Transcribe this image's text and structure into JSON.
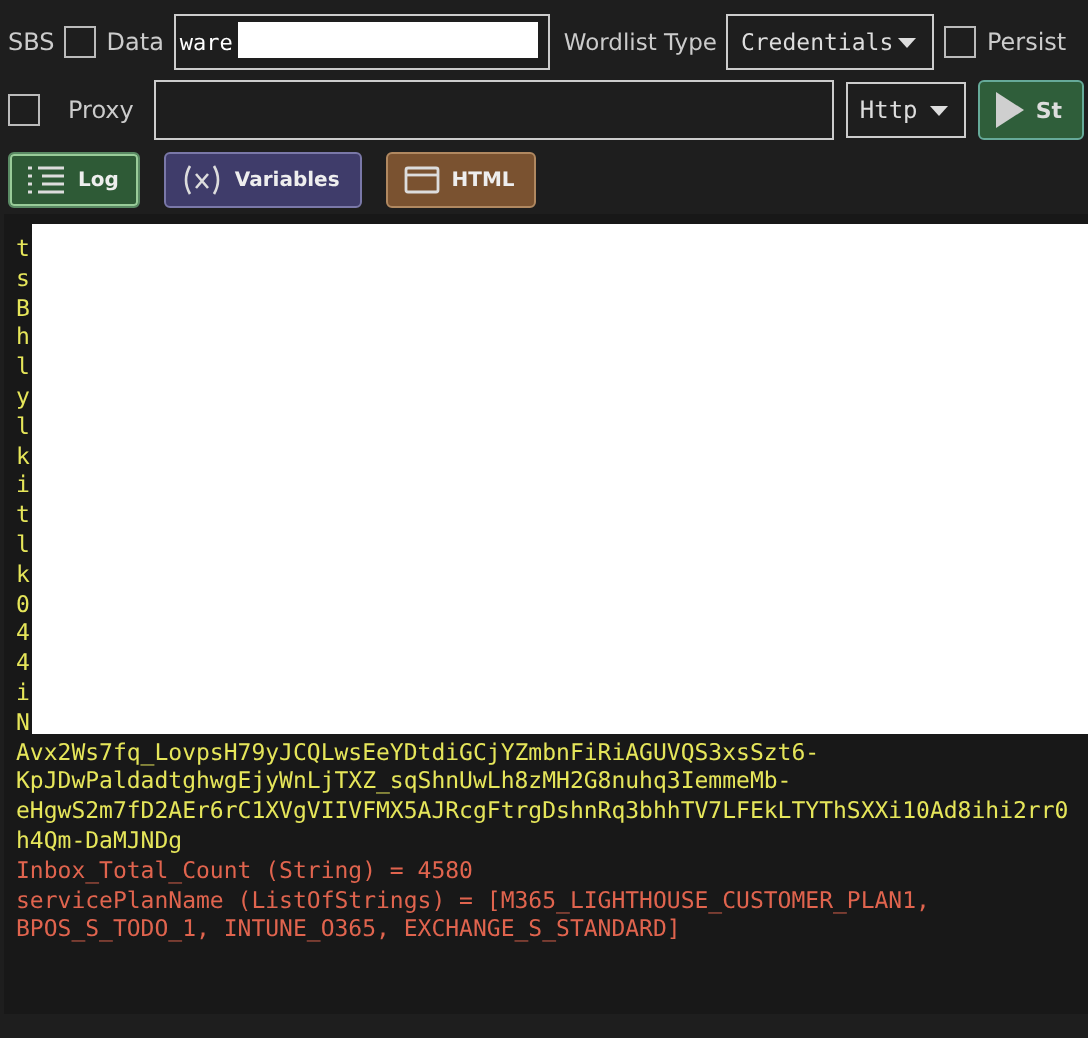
{
  "toolbar": {
    "sbs_label": "SBS",
    "data_checkbox": {
      "checked": false
    },
    "data_label": "Data",
    "data_field": {
      "value": "ware"
    },
    "wordlist_label": "Wordlist Type",
    "wordlist_select": {
      "value": "Credentials"
    },
    "persist_checkbox": {
      "checked": false
    },
    "persist_label": "Persist"
  },
  "proxy_row": {
    "proxy_checkbox": {
      "checked": false
    },
    "proxy_label": "Proxy",
    "proxy_type": {
      "value": "Http"
    },
    "start_button": "St"
  },
  "tabs": [
    {
      "label": "Log",
      "kind": "log",
      "selected": true
    },
    {
      "label": "Variables",
      "kind": "variables",
      "selected": false
    },
    {
      "label": "HTML",
      "kind": "html",
      "selected": false
    }
  ],
  "log": {
    "lines": [
      {
        "kind": "edge",
        "start": "t"
      },
      {
        "kind": "edge",
        "start": "s"
      },
      {
        "kind": "edge",
        "start": "B"
      },
      {
        "kind": "edge",
        "start": "h"
      },
      {
        "kind": "edge",
        "start": "l"
      },
      {
        "kind": "edge",
        "start": "y"
      },
      {
        "kind": "edge",
        "start": "l"
      },
      {
        "kind": "edge",
        "start": "k"
      },
      {
        "kind": "edge",
        "start": "i"
      },
      {
        "kind": "edge",
        "start": "t"
      },
      {
        "kind": "edge",
        "start": "l"
      },
      {
        "kind": "edge",
        "start": "k"
      },
      {
        "kind": "edge",
        "start": "0"
      },
      {
        "kind": "edge",
        "start": "4"
      },
      {
        "kind": "edge",
        "start": "4"
      },
      {
        "kind": "edge",
        "start": "i"
      },
      {
        "kind": "edge",
        "start": "N"
      },
      {
        "kind": "output",
        "text": "Avx2Ws7fq_LovpsH79yJCQLwsEeYDtdiGCjYZmbnFiRiAGUVQS3xsSzt6-"
      },
      {
        "kind": "output",
        "text": "KpJDwPaldadtghwgEjyWnLjTXZ_sqShnUwLh8zMH2G8nuhq3IemmeMb-"
      },
      {
        "kind": "output",
        "text": "eHgwS2m7fD2AEr6rC1XVgVIIVFMX5AJRcgFtrgDshnRq3bhhTV7LFEkLTYThSXXi10Ad8ihi2rr0"
      },
      {
        "kind": "output",
        "text": "h4Qm-DaMJNDg"
      },
      {
        "kind": "variable",
        "text": "Inbox_Total_Count (String) = 4580"
      },
      {
        "kind": "variable",
        "text": "servicePlanName (ListOfStrings) = [M365_LIGHTHOUSE_CUSTOMER_PLAN1,"
      },
      {
        "kind": "variable",
        "text": "BPOS_S_TODO_1, INTUNE_O365, EXCHANGE_S_STANDARD]"
      }
    ]
  }
}
